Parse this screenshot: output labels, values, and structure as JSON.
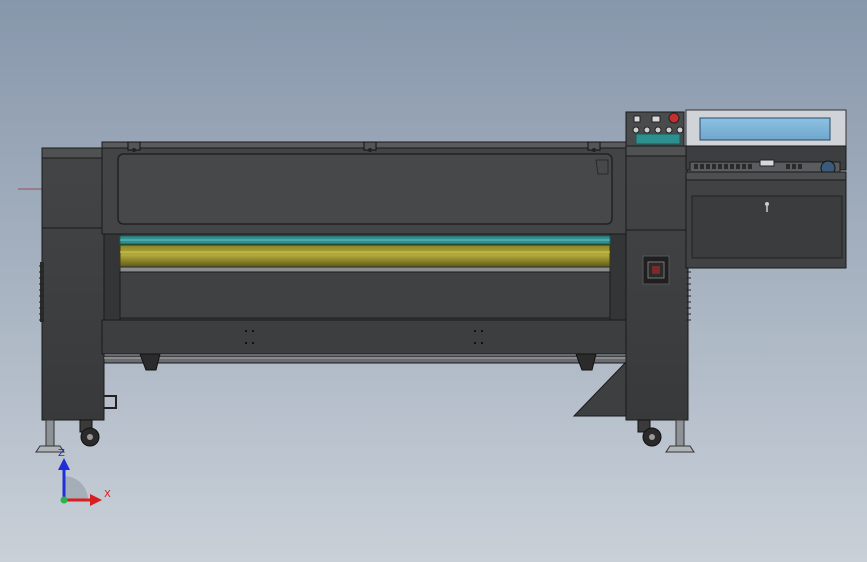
{
  "viewport": {
    "background_top": "#8797ab",
    "background_bottom": "#c9d0d8"
  },
  "triad": {
    "z_label": "Z",
    "x_label": "X",
    "z_color": "#1f2fd8",
    "x_color": "#d81f1f",
    "origin_color": "#2bb24a"
  },
  "model": {
    "body_color": "#3c3d3f",
    "edge_color": "#1a1a1a",
    "window_color": "#4a4b4d",
    "roller_color": "#6e6a1c",
    "roller_highlight": "#a9a23a",
    "teal_color": "#2e8f8f",
    "screen_color": "#7fb6d8"
  }
}
